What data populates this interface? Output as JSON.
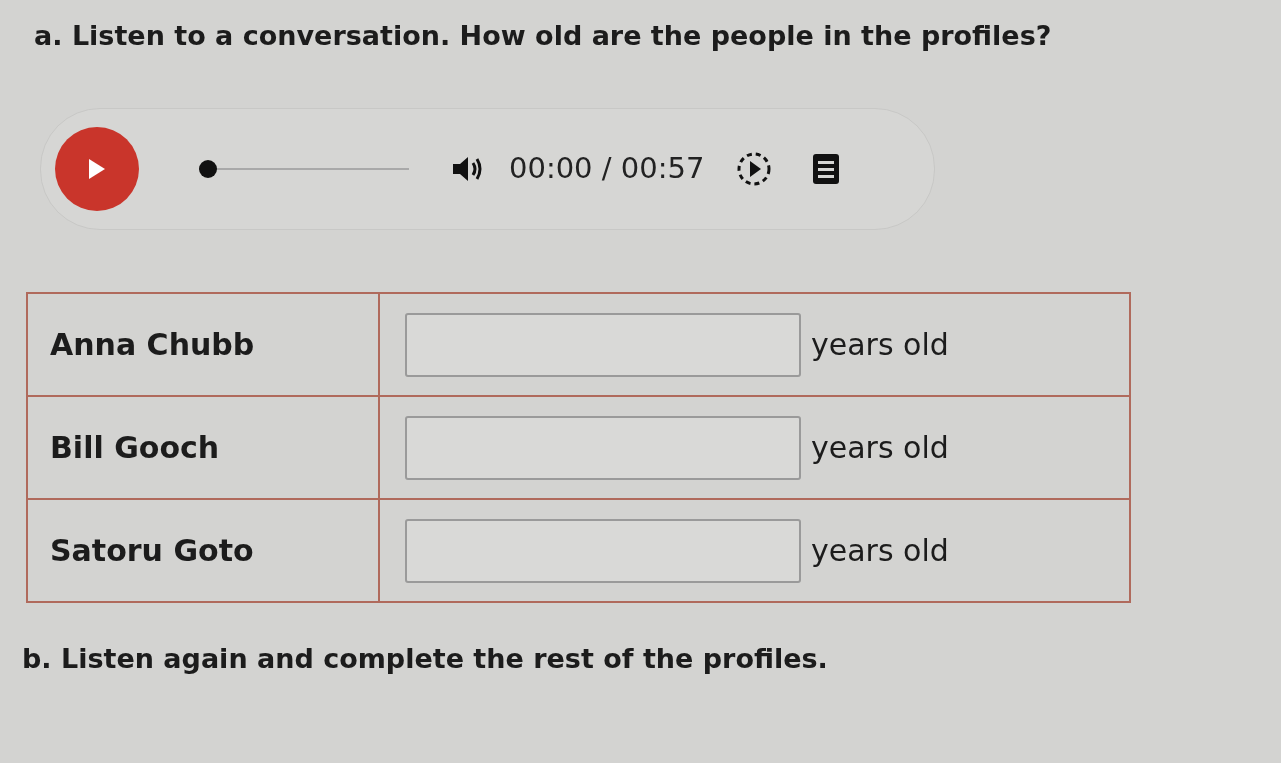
{
  "part_a": {
    "instruction": "a. Listen to a conversation. How old are the people in the profiles?"
  },
  "audio_player": {
    "playing": false,
    "level": 0,
    "time": "00:00 / 00:57"
  },
  "profiles": [
    {
      "name": "Anna Chubb",
      "unit": "years old"
    },
    {
      "name": "Bill Gooch",
      "unit": "years old"
    },
    {
      "name": "Satoru Goto",
      "unit": "years old"
    }
  ],
  "part_b": {
    "instruction": "b. Listen again and complete the rest of the profiles."
  }
}
